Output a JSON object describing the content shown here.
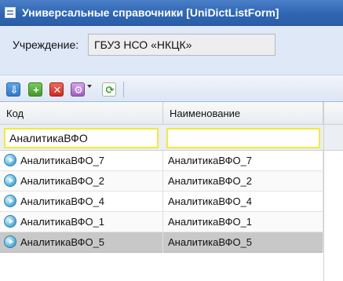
{
  "window": {
    "title": "Универсальные справочники [UniDictListForm]"
  },
  "form": {
    "institution_label": "Учреждение:",
    "institution_value": "ГБУЗ НСО «НКЦК»"
  },
  "toolbar": {
    "buttons": [
      "import-icon",
      "add-icon",
      "delete-icon",
      "settings-icon",
      "refresh-icon"
    ]
  },
  "grid": {
    "columns": [
      "Код",
      "Наименование"
    ],
    "filters": {
      "code": "АналитикаВФО",
      "name": ""
    },
    "rows": [
      {
        "code": "АналитикаВФО_7",
        "name": "АналитикаВФО_7"
      },
      {
        "code": "АналитикаВФО_2",
        "name": "АналитикаВФО_2"
      },
      {
        "code": "АналитикаВФО_4",
        "name": "АналитикаВФО_4"
      },
      {
        "code": "АналитикаВФО_1",
        "name": "АналитикаВФО_1"
      },
      {
        "code": "АналитикаВФО_5",
        "name": "АналитикаВФО_5"
      }
    ],
    "selected_row": "АналитикаВФО_5"
  },
  "colors": {
    "title_bar": "#2f66b3",
    "filter_highlight": "#f2ea3a",
    "selected_row": "#c8c8c8"
  }
}
